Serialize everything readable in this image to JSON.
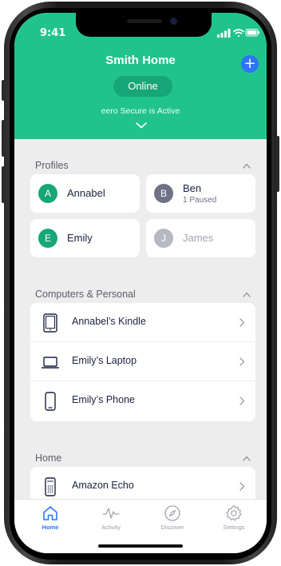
{
  "status_bar": {
    "time": "9:41"
  },
  "header": {
    "network_name": "Smith Home",
    "status": "Online",
    "secure_text": "eero Secure is Active",
    "add_icon": "plus-icon",
    "expand_icon": "chevron-down-icon",
    "background_color": "#21c38c",
    "accent_color": "#2f74ff"
  },
  "profiles": {
    "title": "Profiles",
    "items": [
      {
        "initial": "A",
        "name": "Annabel",
        "subtitle": "",
        "color": "#17a677"
      },
      {
        "initial": "B",
        "name": "Ben",
        "subtitle": "1 Paused",
        "color": "#6e7287"
      },
      {
        "initial": "E",
        "name": "Emily",
        "subtitle": "",
        "color": "#17a677"
      },
      {
        "initial": "J",
        "name": "James",
        "subtitle": "",
        "color": "#b7b8c2"
      }
    ]
  },
  "computers": {
    "title": "Computers & Personal",
    "devices": [
      {
        "name": "Annabel’s Kindle",
        "icon": "tablet-icon"
      },
      {
        "name": "Emily’s Laptop",
        "icon": "laptop-icon"
      },
      {
        "name": "Emily’s Phone",
        "icon": "phone-icon"
      }
    ]
  },
  "home": {
    "title": "Home",
    "devices": [
      {
        "name": "Amazon Echo",
        "icon": "speaker-icon"
      }
    ]
  },
  "tabs": [
    {
      "label": "Home",
      "icon": "home-icon",
      "active": true
    },
    {
      "label": "Activity",
      "icon": "activity-icon",
      "active": false
    },
    {
      "label": "Discover",
      "icon": "compass-icon",
      "active": false
    },
    {
      "label": "Settings",
      "icon": "gear-icon",
      "active": false
    }
  ]
}
